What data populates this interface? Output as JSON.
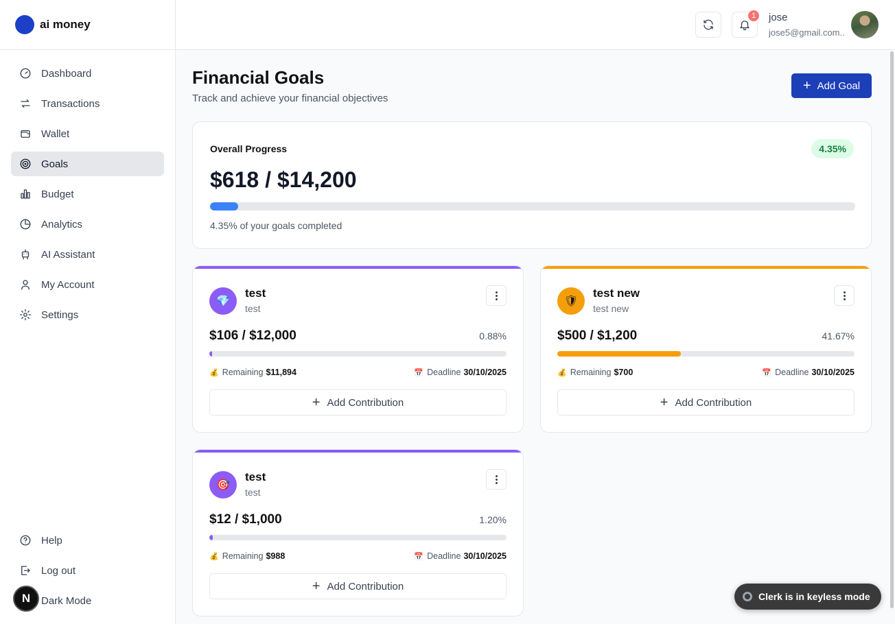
{
  "brand": {
    "name": "ai money",
    "logo_color": "#1d40c8"
  },
  "sidebar": {
    "items": [
      {
        "label": "Dashboard",
        "icon": "gauge-icon",
        "active": false
      },
      {
        "label": "Transactions",
        "icon": "arrows-exchange-icon",
        "active": false
      },
      {
        "label": "Wallet",
        "icon": "wallet-icon",
        "active": false
      },
      {
        "label": "Goals",
        "icon": "target-icon",
        "active": true
      },
      {
        "label": "Budget",
        "icon": "bar-chart-icon",
        "active": false
      },
      {
        "label": "Analytics",
        "icon": "pie-chart-icon",
        "active": false
      },
      {
        "label": "AI Assistant",
        "icon": "bot-icon",
        "active": false
      },
      {
        "label": "My Account",
        "icon": "user-icon",
        "active": false
      },
      {
        "label": "Settings",
        "icon": "gear-icon",
        "active": false
      }
    ],
    "bottom": [
      {
        "label": "Help",
        "icon": "help-circle-icon"
      },
      {
        "label": "Log out",
        "icon": "logout-icon"
      },
      {
        "label": "Dark Mode",
        "icon": "moon-icon"
      }
    ],
    "dark_toggle_letter": "N"
  },
  "topbar": {
    "notification_count": "1",
    "user_name": "jose",
    "user_email": "jose5@gmail.com.."
  },
  "page": {
    "title": "Financial Goals",
    "subtitle": "Track and achieve your financial objectives",
    "add_goal_label": "Add Goal"
  },
  "overall": {
    "label": "Overall Progress",
    "percent_badge": "4.35%",
    "amount": "$618 / $14,200",
    "progress_fraction": 0.0435,
    "caption": "4.35% of your goals completed"
  },
  "goals": [
    {
      "name": "test",
      "description": "test",
      "icon": "gem-icon",
      "glyph": "💎",
      "color": "#8b5cf6",
      "amount": "$106 / $12,000",
      "percent": "0.88%",
      "progress_fraction": 0.0088,
      "remaining_label": "Remaining",
      "remaining": "$11,894",
      "deadline_label": "Deadline",
      "deadline": "30/10/2025",
      "contribute_label": "Add Contribution"
    },
    {
      "name": "test new",
      "description": "test new",
      "icon": "shield-icon",
      "glyph": "🛡",
      "color": "#f59e0b",
      "amount": "$500 / $1,200",
      "percent": "41.67%",
      "progress_fraction": 0.4167,
      "remaining_label": "Remaining",
      "remaining": "$700",
      "deadline_label": "Deadline",
      "deadline": "30/10/2025",
      "contribute_label": "Add Contribution"
    },
    {
      "name": "test",
      "description": "test",
      "icon": "dartboard-icon",
      "glyph": "🎯",
      "color": "#8b5cf6",
      "amount": "$12 / $1,000",
      "percent": "1.20%",
      "progress_fraction": 0.012,
      "remaining_label": "Remaining",
      "remaining": "$988",
      "deadline_label": "Deadline",
      "deadline": "30/10/2025",
      "contribute_label": "Add Contribution"
    }
  ],
  "toast": {
    "text": "Clerk is in keyless mode"
  }
}
